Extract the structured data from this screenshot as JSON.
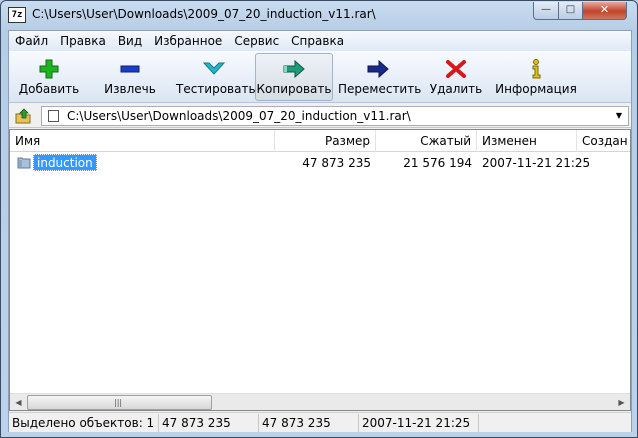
{
  "window": {
    "app_icon_text": "7z",
    "title": "C:\\Users\\User\\Downloads\\2009_07_20_induction_v11.rar\\",
    "min_glyph": "—",
    "max_glyph": "□",
    "close_glyph": "✕"
  },
  "menu": [
    "Файл",
    "Правка",
    "Вид",
    "Избранное",
    "Сервис",
    "Справка"
  ],
  "toolbar": {
    "add": {
      "label": "Добавить",
      "icon": "plus-icon",
      "color": "#1db41d"
    },
    "extract": {
      "label": "Извлечь",
      "icon": "minus-icon",
      "color": "#1a3cc8"
    },
    "test": {
      "label": "Тестировать",
      "icon": "check-icon",
      "color": "#25b7c9"
    },
    "copy": {
      "label": "Копировать",
      "icon": "copy-arrow-icon",
      "color": "#1d9b7a"
    },
    "move": {
      "label": "Переместить",
      "icon": "move-arrow-icon",
      "color": "#1a2a8a"
    },
    "delete": {
      "label": "Удалить",
      "icon": "delete-x-icon",
      "color": "#d41a1a"
    },
    "info": {
      "label": "Информация",
      "icon": "info-icon",
      "color": "#e0c020"
    }
  },
  "address": {
    "path": "C:\\Users\\User\\Downloads\\2009_07_20_induction_v11.rar\\",
    "dropdown_glyph": "▼"
  },
  "list": {
    "columns": {
      "name": "Имя",
      "size": "Размер",
      "packed": "Сжатый",
      "modified": "Изменен",
      "created": "Создан"
    },
    "rows": [
      {
        "name": "induction",
        "size": "47 873 235",
        "packed": "21 576 194",
        "modified": "2007-11-21 21:25",
        "icon": "folder-icon",
        "selected": true
      }
    ]
  },
  "scrollbar": {
    "left_arrow": "◀",
    "right_arrow": "▶",
    "grip": "|||"
  },
  "status": {
    "selected": "Выделено объектов: 1",
    "size": "47 873 235",
    "size2": "47 873 235",
    "date": "2007-11-21 21:25"
  }
}
